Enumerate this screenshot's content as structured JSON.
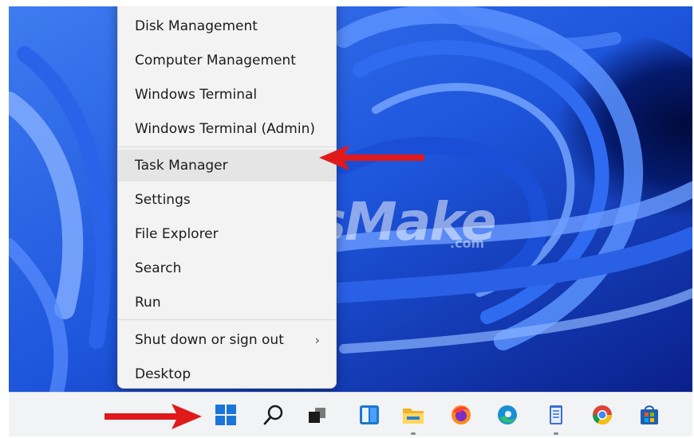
{
  "watermark": {
    "brand": "TipsMake",
    "suffix": ".com"
  },
  "start_menu": {
    "items": [
      {
        "label": "Disk Management"
      },
      {
        "label": "Computer Management"
      },
      {
        "label": "Windows Terminal"
      },
      {
        "label": "Windows Terminal (Admin)"
      },
      {
        "label": "Task Manager"
      },
      {
        "label": "Settings"
      },
      {
        "label": "File Explorer"
      },
      {
        "label": "Search"
      },
      {
        "label": "Run"
      },
      {
        "label": "Shut down or sign out"
      },
      {
        "label": "Desktop"
      }
    ],
    "highlighted_item": "Task Manager",
    "submenu_chevron": "›"
  },
  "taskbar": {
    "icons": [
      "windows-start-icon",
      "search-icon",
      "task-view-icon",
      "widgets-icon",
      "file-explorer-icon",
      "firefox-icon",
      "edge-icon",
      "notepad-icon",
      "chrome-icon",
      "store-icon"
    ]
  },
  "annotations": {
    "arrow_color": "#e0191b"
  },
  "colors": {
    "accent": "#0067c0",
    "menu_bg": "#f3f3f3",
    "wallpaper": "#1f58e0"
  }
}
